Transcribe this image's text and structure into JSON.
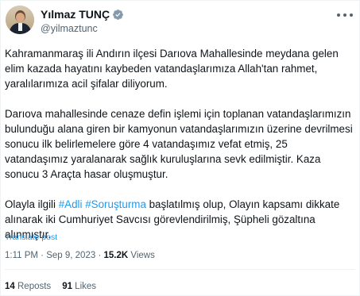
{
  "author": {
    "display_name": "Yılmaz TUNÇ",
    "handle": "@yilmaztunc"
  },
  "tweet": {
    "paragraph_1": "Kahramanmaraş ili Andırın ilçesi Darıova Mahallesinde meydana gelen elim kazada hayatını kaybeden vatandaşlarımıza Allah'tan rahmet, yaralılarımıza acil şifalar diliyorum.",
    "paragraph_2": "Darıova mahallesinde cenaze  defin işlemi için toplanan vatandaşlarımızın bulunduğu alana giren bir kamyonun vatandaşlarımızın üzerine devrilmesi sonucu ilk belirlemelere göre 4 vatandaşımız vefat etmiş, 25 vatandaşımız yaralanarak sağlık kuruluşlarına sevk edilmiştir. Kaza sonucu 3 Araçta hasar oluşmuştur.",
    "paragraph_3_prefix": "Olayla ilgili ",
    "hashtag_1": "#Adli",
    "hashtag_2": "#Soruşturma",
    "paragraph_3_suffix": " başlatılmış olup, Olayın kapsamı dikkate alınarak iki Cumhuriyet Savcısı görevlendirilmiş, Şüpheli gözaltına alınmıştır."
  },
  "translate_label": "Translate post",
  "meta": {
    "time": "1:11 PM",
    "separator": " · ",
    "date": "Sep 9, 2023",
    "views_count": "15.2K",
    "views_label": " Views"
  },
  "stats": {
    "reposts_count": "14",
    "reposts_label": " Reposts",
    "likes_count": "91",
    "likes_label": " Likes"
  },
  "icons": {
    "verified": "verified-badge-icon",
    "more": "more-options-icon"
  },
  "colors": {
    "accent": "#1d9bf0",
    "text": "#0f1419",
    "secondary": "#536471"
  }
}
